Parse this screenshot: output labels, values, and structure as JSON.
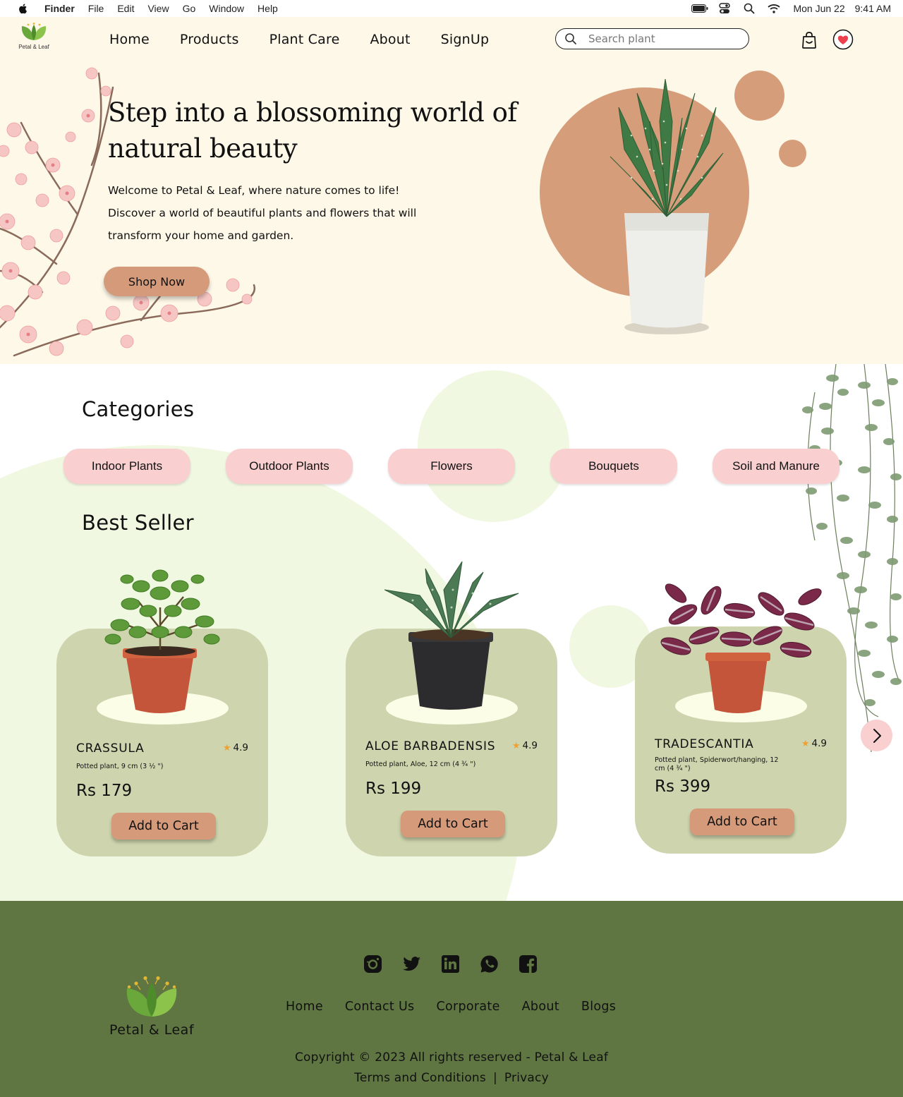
{
  "menubar": {
    "app": "Finder",
    "menus": [
      "File",
      "Edit",
      "View",
      "Go",
      "Window",
      "Help"
    ],
    "date": "Mon Jun 22",
    "time": "9:41 AM"
  },
  "header": {
    "logo_text": "Petal & Leaf",
    "nav": [
      "Home",
      "Products",
      "Plant Care",
      "About",
      "SignUp"
    ],
    "search_placeholder": "Search plant"
  },
  "hero": {
    "title_line1": "Step into a blossoming world of",
    "title_line2": "natural beauty",
    "text_line1": "Welcome to Petal & Leaf, where nature comes to life!",
    "text_line2": "Discover a world of beautiful plants and flowers that will",
    "text_line3": "transform your home and garden.",
    "cta": "Shop Now"
  },
  "categories": {
    "title": "Categories",
    "items": [
      "Indoor Plants",
      "Outdoor Plants",
      "Flowers",
      "Bouquets",
      "Soil and Manure"
    ]
  },
  "best_seller": {
    "title": "Best Seller",
    "products": [
      {
        "name": "CRASSULA",
        "rating": "4.9",
        "desc": "Potted plant, 9 cm (3 ½ \")",
        "price": "Rs 179",
        "cta": "Add to Cart"
      },
      {
        "name": "ALOE BARBADENSIS",
        "rating": "4.9",
        "desc": "Potted plant, Aloe, 12 cm (4 ¾ \")",
        "price": "Rs 199",
        "cta": "Add to Cart"
      },
      {
        "name": "TRADESCANTIA",
        "rating": "4.9",
        "desc": "Potted plant, Spiderwort/hanging, 12 cm (4 ¾ \")",
        "price": "Rs 399",
        "cta": "Add to Cart"
      }
    ]
  },
  "footer": {
    "brand": "Petal & Leaf",
    "links": [
      "Home",
      "Contact Us",
      "Corporate",
      "About",
      "Blogs"
    ],
    "copyright": "Copyright © 2023 All rights reserved - Petal & Leaf",
    "terms": "Terms and Conditions",
    "separator": "|",
    "privacy": "Privacy",
    "social_icons": [
      "instagram-icon",
      "twitter-icon",
      "linkedin-icon",
      "whatsapp-icon",
      "facebook-icon"
    ]
  },
  "colors": {
    "hero_bg": "#fef8e8",
    "accent": "#d49a7a",
    "category_pill": "#f9cfd0",
    "card_bg": "#ced5ae",
    "footer_bg": "#5f7642"
  }
}
